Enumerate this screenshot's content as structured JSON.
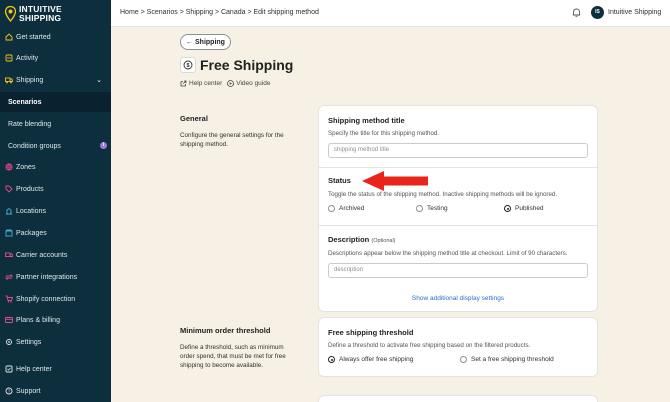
{
  "brand": {
    "line1": "INTUITIVE",
    "line2": "SHIPPING"
  },
  "sidebar": {
    "items": [
      {
        "label": "Get started",
        "icon": "home-icon"
      },
      {
        "label": "Activity",
        "icon": "activity-icon"
      },
      {
        "label": "Shipping",
        "icon": "truck-icon"
      },
      {
        "label": "Scenarios"
      },
      {
        "label": "Rate blending"
      },
      {
        "label": "Condition groups"
      },
      {
        "label": "Zones",
        "icon": "globe-icon"
      },
      {
        "label": "Products",
        "icon": "tag-icon"
      },
      {
        "label": "Locations",
        "icon": "location-icon"
      },
      {
        "label": "Packages",
        "icon": "package-icon"
      },
      {
        "label": "Carrier accounts",
        "icon": "carrier-icon"
      },
      {
        "label": "Partner integrations",
        "icon": "integration-icon"
      },
      {
        "label": "Shopify connection",
        "icon": "cart-icon"
      },
      {
        "label": "Plans & billing",
        "icon": "billing-icon"
      },
      {
        "label": "Settings",
        "icon": "gear-icon"
      },
      {
        "label": "Help center",
        "icon": "help-icon"
      },
      {
        "label": "Support",
        "icon": "support-icon"
      }
    ]
  },
  "topbar": {
    "breadcrumb": "Home > Scenarios > Shipping > Canada > Edit shipping method",
    "avatar_initials": "IS",
    "account_name": "Intuitive Shipping"
  },
  "page": {
    "back_label": "Shipping",
    "title": "Free Shipping",
    "help_link": "Help center",
    "video_link": "Video guide"
  },
  "general": {
    "title": "General",
    "description": "Configure the general settings for the shipping method."
  },
  "method_title": {
    "label": "Shipping method title",
    "hint": "Specify the title for this shipping method.",
    "placeholder": "shipping method title"
  },
  "status": {
    "label": "Status",
    "hint": "Toggle the status of the shipping method. Inactive shipping methods will be ignored.",
    "options": [
      "Archived",
      "Testing",
      "Published"
    ],
    "selected": "Published"
  },
  "description": {
    "label": "Description",
    "optional": "(Optional)",
    "hint": "Descriptions appear below the shipping method title at checkout. Limit of 90 characters.",
    "placeholder": "description",
    "show_more": "Show additional display settings"
  },
  "minimum": {
    "title": "Minimum order threshold",
    "description": "Define a threshold, such as minimum order spend, that must be met for free shipping to become available."
  },
  "free_threshold": {
    "label": "Free shipping threshold",
    "hint": "Define a threshold to activate free shipping based on the filtered products.",
    "options": [
      "Always offer free shipping",
      "Set a free shipping threshold"
    ],
    "selected": "Always offer free shipping"
  },
  "colors": {
    "sidebar": "#0d2e3d",
    "background": "#f6f1e4",
    "annotation_arrow": "#e8241b",
    "link": "#2c6ecb"
  }
}
